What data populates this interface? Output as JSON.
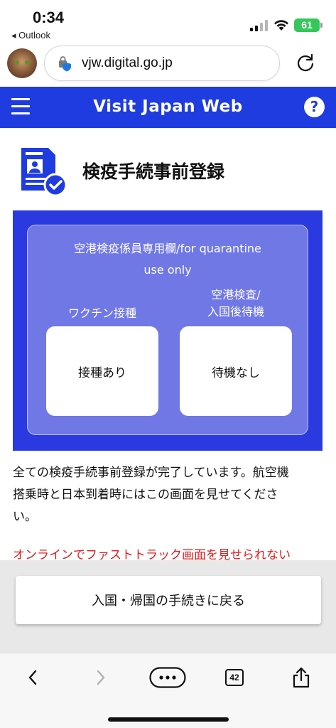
{
  "status_bar": {
    "time": "0:34",
    "back_app": "◂ Outlook",
    "battery": "61"
  },
  "browser": {
    "url": "vjw.digital.go.jp",
    "tabs_count": "42"
  },
  "header": {
    "title": "Visit Japan Web",
    "help": "?"
  },
  "page": {
    "title": "検疫手続事前登録"
  },
  "quarantine": {
    "heading_line1": "空港検疫係員専用欄/for quarantine",
    "heading_line2": "use only",
    "vaccination_label": "ワクチン接種",
    "airport_label_line1": "空港検査/",
    "airport_label_line2": "入国後待機",
    "vaccination_value": "接種あり",
    "airport_value": "待機なし"
  },
  "body": {
    "text_line1": "全ての検疫手続事前登録が完了しています。航空機",
    "text_line2": "搭乗時と日本到着時にはこの画面を見せてくださ",
    "text_line3": "い。",
    "warning": "オンラインでファストトラック画面を見せられない"
  },
  "actions": {
    "return_label": "入国・帰国の手続きに戻る"
  },
  "colors": {
    "brand_blue": "#1f3ce0",
    "panel_blue": "#2a3ae0",
    "panel_inner": "#7078e6",
    "warning_red": "#e01b1b",
    "battery_green": "#35c759"
  }
}
